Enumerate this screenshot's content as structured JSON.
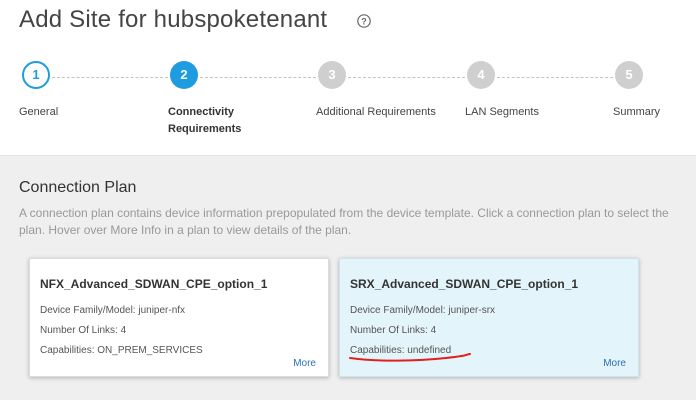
{
  "header": {
    "title": "Add Site for hubspoketenant"
  },
  "wizard": {
    "steps": [
      {
        "number": "1",
        "label": "General",
        "state": "done"
      },
      {
        "number": "2",
        "label_line1": "Connectivity",
        "label_line2": "Requirements",
        "state": "active"
      },
      {
        "number": "3",
        "label": "Additional Requirements",
        "state": "future"
      },
      {
        "number": "4",
        "label": "LAN Segments",
        "state": "future"
      },
      {
        "number": "5",
        "label": "Summary",
        "state": "future"
      }
    ]
  },
  "connection_plan": {
    "title": "Connection Plan",
    "description": "A connection plan contains device information prepopulated from the device template. Click a connection plan to select the plan. Hover over More Info in a plan to view details of the plan.",
    "cards": [
      {
        "name": "NFX_Advanced_SDWAN_CPE_option_1",
        "device_family": "Device Family/Model: juniper-nfx",
        "links": "Number Of Links: 4",
        "capabilities": "Capabilities: ON_PREM_SERVICES",
        "more": "More",
        "selected": false
      },
      {
        "name": "SRX_Advanced_SDWAN_CPE_option_1",
        "device_family": "Device Family/Model: juniper-srx",
        "links": "Number Of Links: 4",
        "capabilities": "Capabilities: undefined",
        "more": "More",
        "selected": true
      }
    ]
  },
  "colors": {
    "accent": "#1d9ce0",
    "inactive_step": "#cfcfcf",
    "selected_card": "#e3f4fb",
    "annotation": "#e0201c",
    "link": "#2f6fb5"
  },
  "icons": {
    "help": "question-circle-icon"
  }
}
